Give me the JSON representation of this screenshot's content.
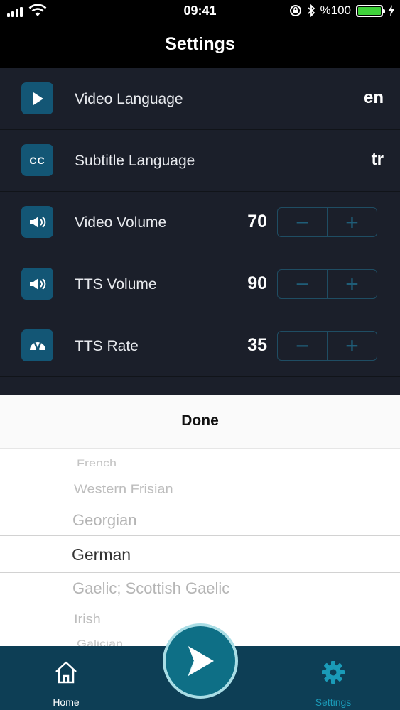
{
  "status_bar": {
    "time": "09:41",
    "battery_text": "%100",
    "battery_level": 1.0,
    "icons": [
      "signal-icon",
      "wifi-icon",
      "orientation-lock-icon",
      "bluetooth-icon",
      "battery-icon",
      "charging-icon"
    ]
  },
  "nav": {
    "title": "Settings"
  },
  "settings": {
    "rows": [
      {
        "label": "Video Language",
        "value": "en",
        "icon": "play-icon"
      },
      {
        "label": "Subtitle Language",
        "value": "tr",
        "icon": "cc-icon",
        "icon_text": "CC"
      },
      {
        "label": "Video Volume",
        "value": "70",
        "icon": "speaker-icon",
        "minus": "−",
        "plus": "+"
      },
      {
        "label": "TTS Volume",
        "value": "90",
        "icon": "speaker-icon",
        "minus": "−",
        "plus": "+"
      },
      {
        "label": "TTS Rate",
        "value": "35",
        "icon": "speedometer-icon",
        "minus": "−",
        "plus": "+"
      }
    ]
  },
  "picker": {
    "done_label": "Done",
    "options": [
      "French",
      "Western Frisian",
      "Georgian",
      "German",
      "Gaelic; Scottish Gaelic",
      "Irish",
      "Galician"
    ],
    "selected": "German"
  },
  "tabbar": {
    "home_label": "Home",
    "settings_label": "Settings"
  },
  "colors": {
    "background": "#1b1f2a",
    "icon_box": "#135675",
    "tabbar": "#0d3e55",
    "accent": "#1a9bb8",
    "battery_green": "#3fd13a"
  }
}
